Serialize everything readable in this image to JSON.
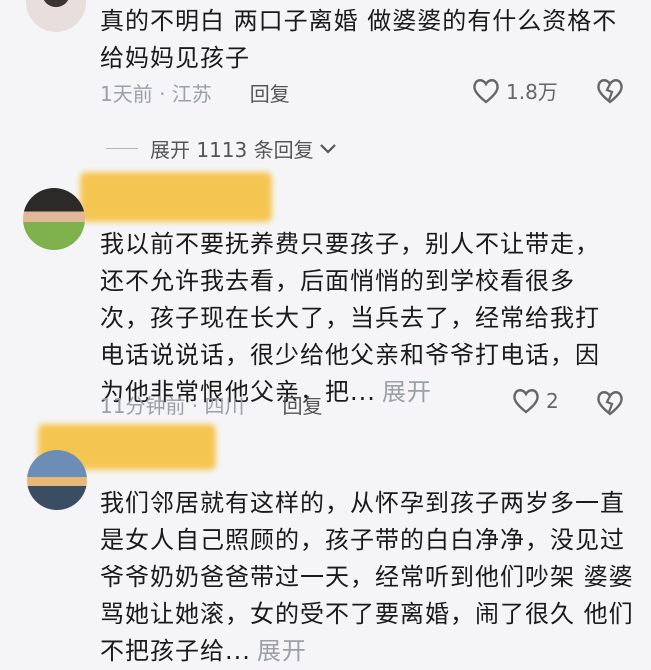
{
  "comments": [
    {
      "text": "真的不明白 两口子离婚 做婆婆的有什么资格不给妈妈见孩子",
      "time_location": "1天前 · 江苏",
      "reply_label": "回复",
      "likes": "1.8万"
    },
    {
      "text": "我以前不要抚养费只要孩子，别人不让带走，还不允许我去看，后面悄悄的到学校看很多次，孩子现在长大了，当兵去了，经常给我打电话说说话，很少给他父亲和爷爷打电话，因为他非常恨他父亲，把...",
      "expand_label": "展开",
      "time_location": "11分钟前 · 四川",
      "reply_label": "回复",
      "likes": "2"
    },
    {
      "text": "我们邻居就有这样的，从怀孕到孩子两岁多一直是女人自己照顾的，孩子带的白白净净，没见过爷爷奶奶爸爸带过一天，经常听到他们吵架 婆婆骂她让她滚，女的受不了要离婚，闹了很久 他们不把孩子给...",
      "expand_label": "展开"
    }
  ],
  "expand_replies_label": "展开 1113 条回复",
  "icons": {
    "like": "heart-outline-icon",
    "dislike": "broken-heart-icon",
    "chevron": "chevron-down-icon"
  }
}
